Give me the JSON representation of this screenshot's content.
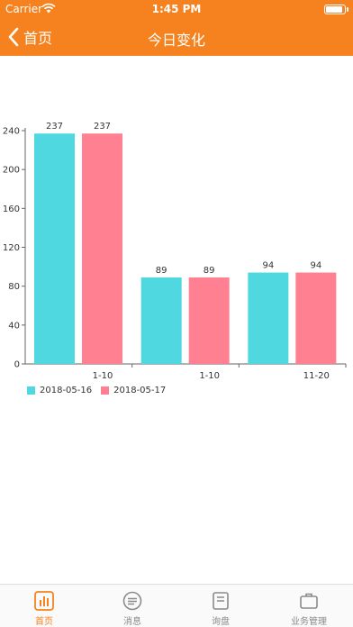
{
  "status": {
    "carrier": "Carrier",
    "time": "1:45 PM"
  },
  "nav": {
    "back_label": "首页",
    "title": "今日变化"
  },
  "colors": {
    "accent": "#f5821f",
    "series1": "#4fd8e0",
    "series2": "#ff8090"
  },
  "chart_data": {
    "type": "bar",
    "categories": [
      "1-10",
      "1-10",
      "11-20"
    ],
    "series": [
      {
        "name": "2018-05-16",
        "values": [
          237,
          89,
          94
        ]
      },
      {
        "name": "2018-05-17",
        "values": [
          237,
          89,
          94
        ]
      }
    ],
    "ylim": [
      0,
      240
    ],
    "yticks": [
      0,
      40,
      80,
      120,
      160,
      200,
      240
    ],
    "grid": false,
    "legend": "bottom-left"
  },
  "tabs": [
    {
      "label": "首页",
      "icon": "chart-icon",
      "active": true
    },
    {
      "label": "消息",
      "icon": "message-icon",
      "active": false
    },
    {
      "label": "询盘",
      "icon": "inquiry-icon",
      "active": false
    },
    {
      "label": "业务管理",
      "icon": "business-icon",
      "active": false
    }
  ]
}
